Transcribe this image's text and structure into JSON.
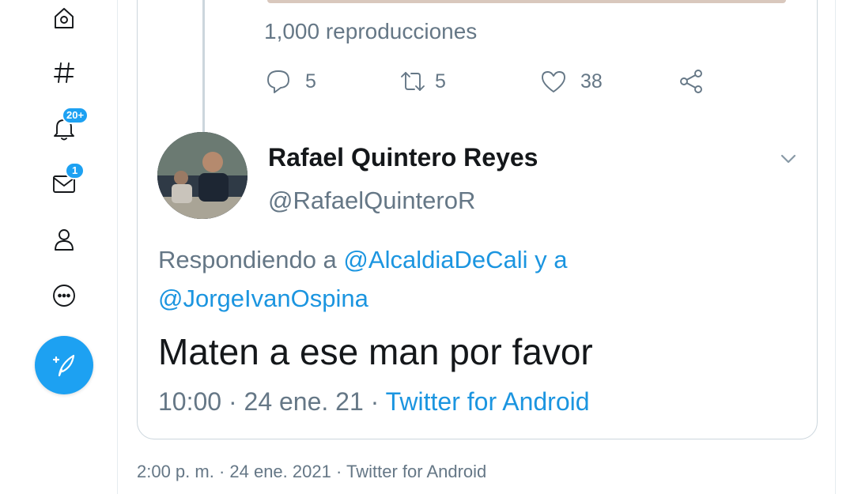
{
  "nav": {
    "notifications_badge": "20+",
    "messages_badge": "1"
  },
  "quoted_tweet": {
    "views": "1,000 reproducciones",
    "reply_count": "5",
    "retweet_count": "5",
    "like_count": "38"
  },
  "reply_tweet": {
    "author_name": "Rafael Quintero Reyes",
    "author_handle": "@RafaelQuinteroR",
    "replying_prefix": "Respondiendo a ",
    "mention_1": "@AlcaldiaDeCali",
    "connector": " y a",
    "mention_2": "@JorgeIvanOspina",
    "text": "Maten a ese man por favor",
    "time_date": "10:00 · 24 ene. 21 · ",
    "source": "Twitter for Android"
  },
  "footer": {
    "meta": "2:00 p. m. · 24 ene. 2021 · Twitter for Android"
  },
  "colors": {
    "accent": "#1da1f2",
    "link": "#1b95e0",
    "muted": "#657786",
    "border": "#ccd6dd"
  },
  "icons": [
    "home-icon",
    "hashtag-icon",
    "bell-icon",
    "mail-icon",
    "profile-icon",
    "more-icon",
    "compose-icon",
    "reply-icon",
    "retweet-icon",
    "heart-icon",
    "share-icon",
    "chevron-down-icon"
  ]
}
